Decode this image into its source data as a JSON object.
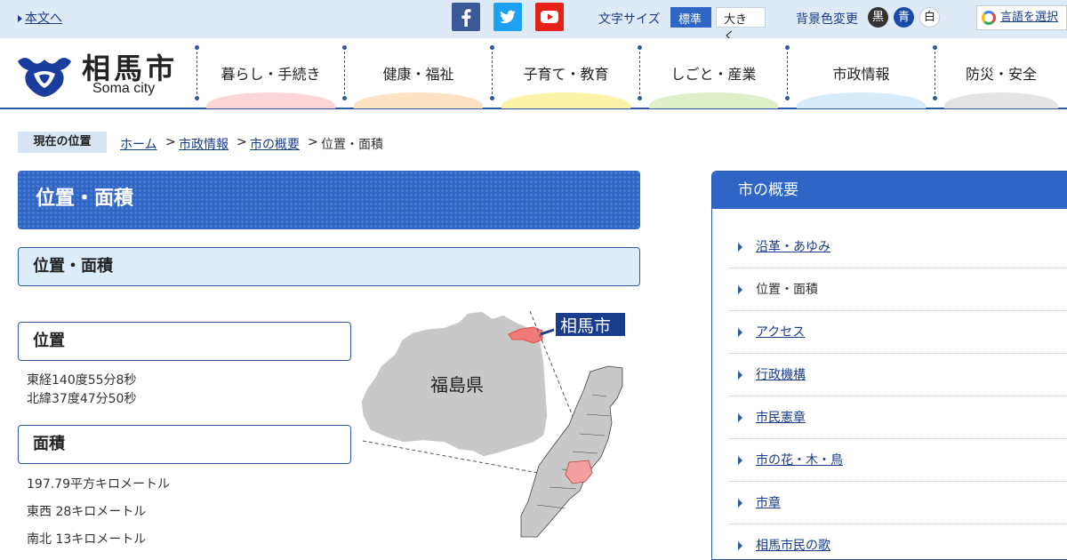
{
  "topbar": {
    "skip_link": "本文へ",
    "fontsize_label": "文字サイズ",
    "fontsize_standard": "標準",
    "fontsize_large": "大きく",
    "bgcolor_label": "背景色変更",
    "bg_black": "黒",
    "bg_blue": "青",
    "bg_white": "白",
    "translate": "言語を選択"
  },
  "header": {
    "logo_jp": "相馬市",
    "logo_en": "Soma city",
    "nav": [
      {
        "label": "暮らし・手続き",
        "color": "#fbd5d8"
      },
      {
        "label": "健康・福祉",
        "color": "#fde3c3"
      },
      {
        "label": "子育て・教育",
        "color": "#fdf3a8"
      },
      {
        "label": "しごと・産業",
        "color": "#dff0c8"
      },
      {
        "label": "市政情報",
        "color": "#d6ecfb"
      },
      {
        "label": "防災・安全",
        "color": "#e4e4e4"
      }
    ]
  },
  "breadcrumb": {
    "label": "現在の位置",
    "items": [
      "ホーム",
      "市政情報",
      "市の概要"
    ],
    "current": "位置・面積"
  },
  "main": {
    "title": "位置・面積",
    "subtitle": "位置・面積",
    "position_heading": "位置",
    "longitude": "東経140度55分8秒",
    "latitude": "北緯37度47分50秒",
    "area_heading": "面積",
    "area": "197.79平方キロメートル",
    "east_west": "東西 28キロメートル",
    "north_south": "南北 13キロメートル",
    "map": {
      "prefecture_label": "福島県",
      "city_label": "相馬市"
    }
  },
  "sidebar": {
    "heading": "市の概要",
    "items": [
      {
        "label": "沿革・あゆみ",
        "current": false
      },
      {
        "label": "位置・面積",
        "current": true
      },
      {
        "label": "アクセス",
        "current": false
      },
      {
        "label": "行政機構",
        "current": false
      },
      {
        "label": "市民憲章",
        "current": false
      },
      {
        "label": "市の花・木・鳥",
        "current": false
      },
      {
        "label": "市章",
        "current": false
      },
      {
        "label": "相馬市民の歌",
        "current": false
      }
    ]
  },
  "colors": {
    "accent": "#2f66c6",
    "link": "#1a3c8c",
    "highlight_city": "#f07a7a"
  }
}
